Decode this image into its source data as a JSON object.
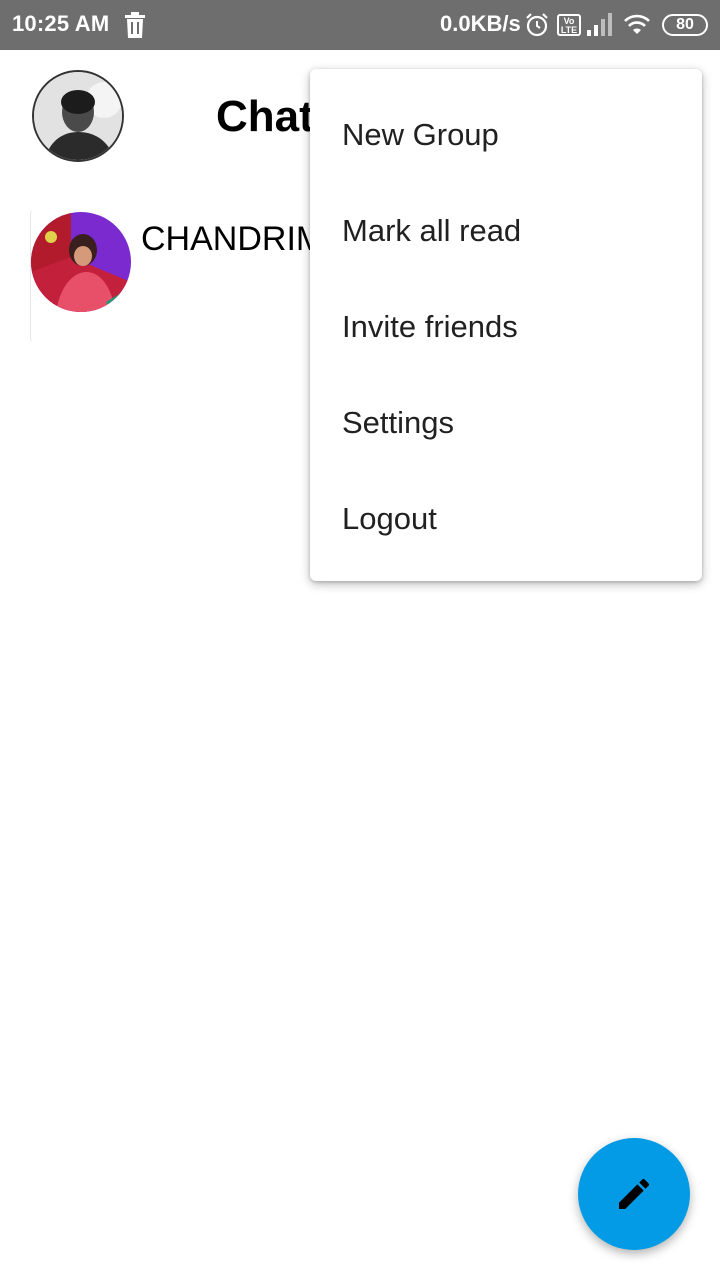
{
  "status_bar": {
    "time": "10:25 AM",
    "net_speed": "0.0KB/s",
    "volte_label": "Vo LTE",
    "battery_level": "80",
    "icons": [
      "trash-icon",
      "alarm-icon",
      "volte-icon",
      "signal-icon",
      "wifi-icon",
      "battery-icon"
    ]
  },
  "header": {
    "title": "Chats",
    "profile_avatar": "profile-avatar"
  },
  "chats": [
    {
      "name": "CHANDRIMA"
    }
  ],
  "menu": {
    "items": [
      "New Group",
      "Mark all read",
      "Invite friends",
      "Settings",
      "Logout"
    ]
  },
  "fab": {
    "icon": "pencil-icon",
    "color": "#039be5"
  },
  "colors": {
    "status_bar": "#6e6e6e",
    "accent": "#039be5"
  }
}
